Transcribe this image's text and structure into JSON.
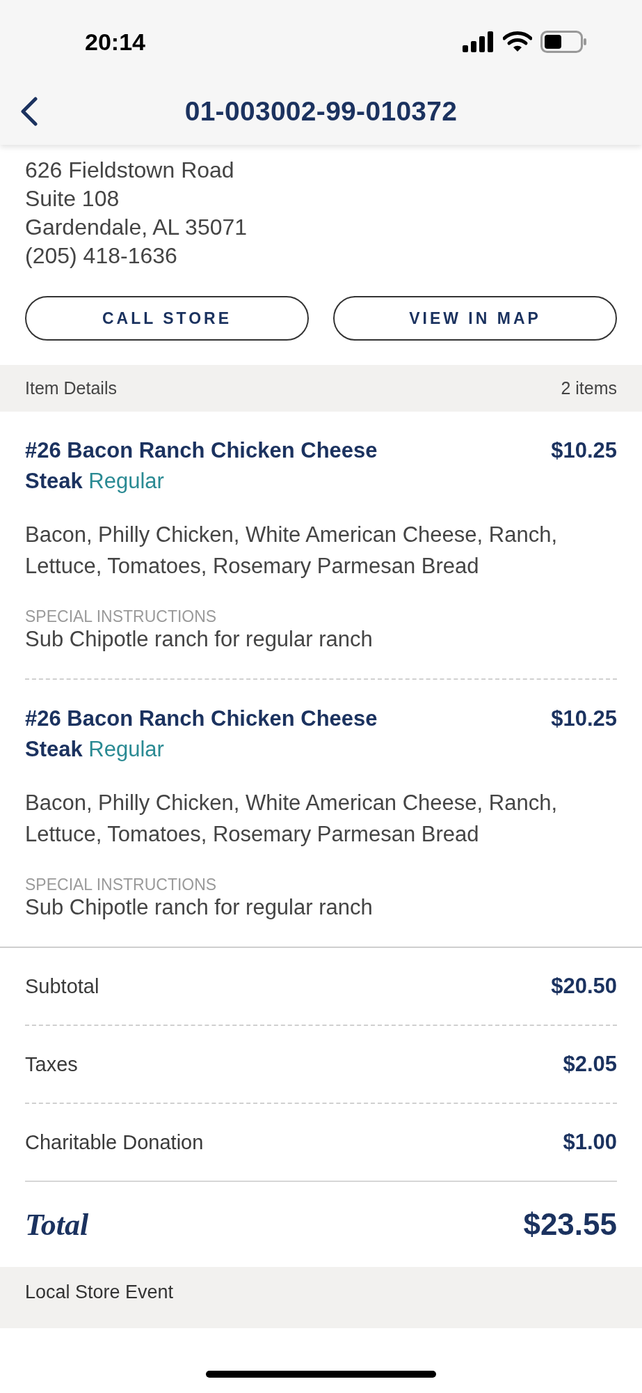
{
  "status_bar": {
    "time": "20:14"
  },
  "header": {
    "title": "01-003002-99-010372"
  },
  "store": {
    "address_lines": [
      "626 Fieldstown Road",
      "Suite 108",
      "Gardendale, AL 35071"
    ],
    "phone": "(205) 418-1636"
  },
  "buttons": [
    {
      "label": "CALL STORE"
    },
    {
      "label": "VIEW IN MAP"
    }
  ],
  "item_details": {
    "title": "Item Details",
    "count": "2 items"
  },
  "items": [
    {
      "title": "**#26 Bacon Ranch Chicken Cheese Steak** Regular",
      "price": "$10.25",
      "ingredients": "Bacon, Philly Chicken, White American Cheese, Ranch, Lettuce, Tomatoes, Rosemary Parmesan Bread",
      "instructions_label": "SPECIAL INSTRUCTIONS",
      "instructions": "Sub Chipotle ranch for regular ranch"
    },
    {
      "title": "**#26 Bacon Ranch Chicken Cheese Steak** Regular",
      "price": "$10.25",
      "ingredients": "Bacon, Philly Chicken, White American Cheese, Ranch, Lettuce, Tomatoes, Rosemary Parmesan Bread",
      "instructions_label": "SPECIAL INSTRUCTIONS",
      "instructions": "Sub Chipotle ranch for regular ranch"
    }
  ],
  "summary": [
    {
      "label": "Subtotal",
      "value": "$20.50"
    },
    {
      "label": "Taxes",
      "value": "$2.05"
    },
    {
      "label": "Charitable Donation",
      "value": "$1.00"
    }
  ],
  "total": {
    "label": "Total",
    "value": "$23.55"
  },
  "footer_section": {
    "title": "Local Store Event"
  }
}
